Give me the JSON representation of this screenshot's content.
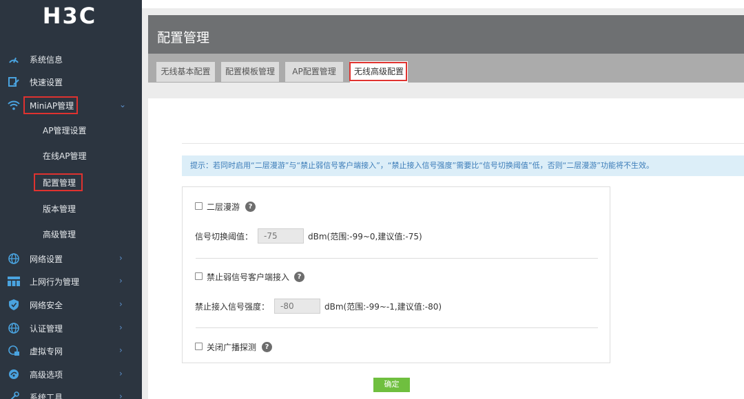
{
  "brand": {
    "logo_text": "H3C"
  },
  "sidebar": {
    "items": [
      {
        "label": "系统信息",
        "icon": "gauge-icon"
      },
      {
        "label": "快速设置",
        "icon": "edit-icon"
      },
      {
        "label": "MiniAP管理",
        "icon": "wifi-icon",
        "expanded": true
      },
      {
        "label": "网络设置",
        "icon": "globe-icon"
      },
      {
        "label": "上网行为管理",
        "icon": "grid-icon"
      },
      {
        "label": "网络安全",
        "icon": "shield-icon"
      },
      {
        "label": "认证管理",
        "icon": "globe-icon"
      },
      {
        "label": "虚拟专网",
        "icon": "network-icon"
      },
      {
        "label": "高级选项",
        "icon": "settings-icon"
      },
      {
        "label": "系统工具",
        "icon": "wrench-icon"
      }
    ],
    "subitems": [
      {
        "label": "AP管理设置"
      },
      {
        "label": "在线AP管理"
      },
      {
        "label": "配置管理",
        "active": true
      },
      {
        "label": "版本管理"
      },
      {
        "label": "高级管理"
      }
    ]
  },
  "header": {
    "title": "配置管理"
  },
  "tabs": [
    {
      "label": "无线基本配置"
    },
    {
      "label": "配置模板管理"
    },
    {
      "label": "AP配置管理"
    },
    {
      "label": "无线高级配置",
      "active": true
    }
  ],
  "tip": "提示：若同时启用“二层漫游”与“禁止弱信号客户端接入”，“禁止接入信号强度”需要比“信号切换阈值”低，否则“二层漫游”功能将不生效。",
  "form": {
    "roaming": {
      "label": "二层漫游",
      "checked": false
    },
    "switch_threshold": {
      "label": "信号切换阈值：",
      "placeholder": "-75",
      "unit": "dBm(范围:-99~0,建议值:-75)"
    },
    "weak_client": {
      "label": "禁止弱信号客户端接入",
      "checked": false
    },
    "access_strength": {
      "label": "禁止接入信号强度：",
      "placeholder": "-80",
      "unit": "dBm(范围:-99~-1,建议值:-80)"
    },
    "broadcast_probe": {
      "label": "关闭广播探测",
      "checked": false
    },
    "help_glyph": "?"
  },
  "buttons": {
    "confirm": "确定"
  },
  "colors": {
    "sidebar_bg": "#2c3540",
    "accent_red": "#e0322f",
    "confirm_green": "#6fbf3f",
    "tip_bg": "#dceef8"
  }
}
